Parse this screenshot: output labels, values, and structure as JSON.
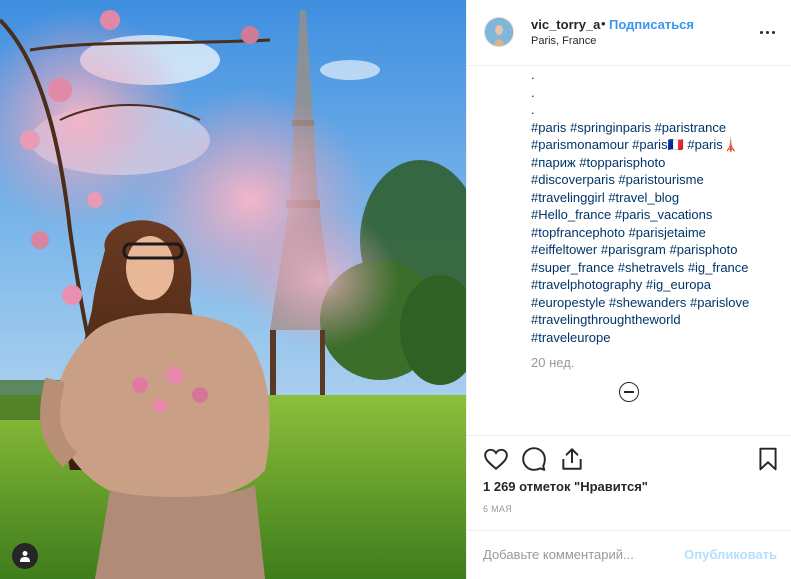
{
  "post": {
    "username": "vic_torry_a",
    "separator": "•",
    "follow_label": "Подписаться",
    "location": "Paris, France",
    "more_icon": "more-horizontal-icon"
  },
  "caption": {
    "dots": [
      ".",
      ".",
      "."
    ],
    "hashtag_lines": [
      "#paris #springinparis #paristrance",
      "#parismonamour #paris🇫🇷 #paris🗼",
      "#париж #topparisphoto",
      "#discoverparis #paristourisme",
      "#travelinggirl #travel_blog",
      "#Hello_france #paris_vacations",
      "#topfrancephoto #parisjetaime",
      "#eiffeltower #parisgram #parisphoto",
      "#super_france #shetravels #ig_france",
      "#travelphotography #ig_europa",
      "#europestyle #shewanders #parislove",
      "#travelingthroughtheworld",
      "#traveleurope"
    ],
    "time_ago": "20 нед."
  },
  "actions": {
    "like_icon": "heart-icon",
    "comment_icon": "comment-icon",
    "share_icon": "share-icon",
    "save_icon": "bookmark-icon"
  },
  "likes_text": "1 269 отметок \"Нравится\"",
  "date_text": "6 мая",
  "comment": {
    "placeholder": "Добавьте комментарий...",
    "publish_label": "Опубликовать"
  },
  "colors": {
    "link_blue": "#3897f0",
    "hashtag_blue": "#003569",
    "muted": "#999999",
    "publish_disabled": "#b2dffc"
  }
}
